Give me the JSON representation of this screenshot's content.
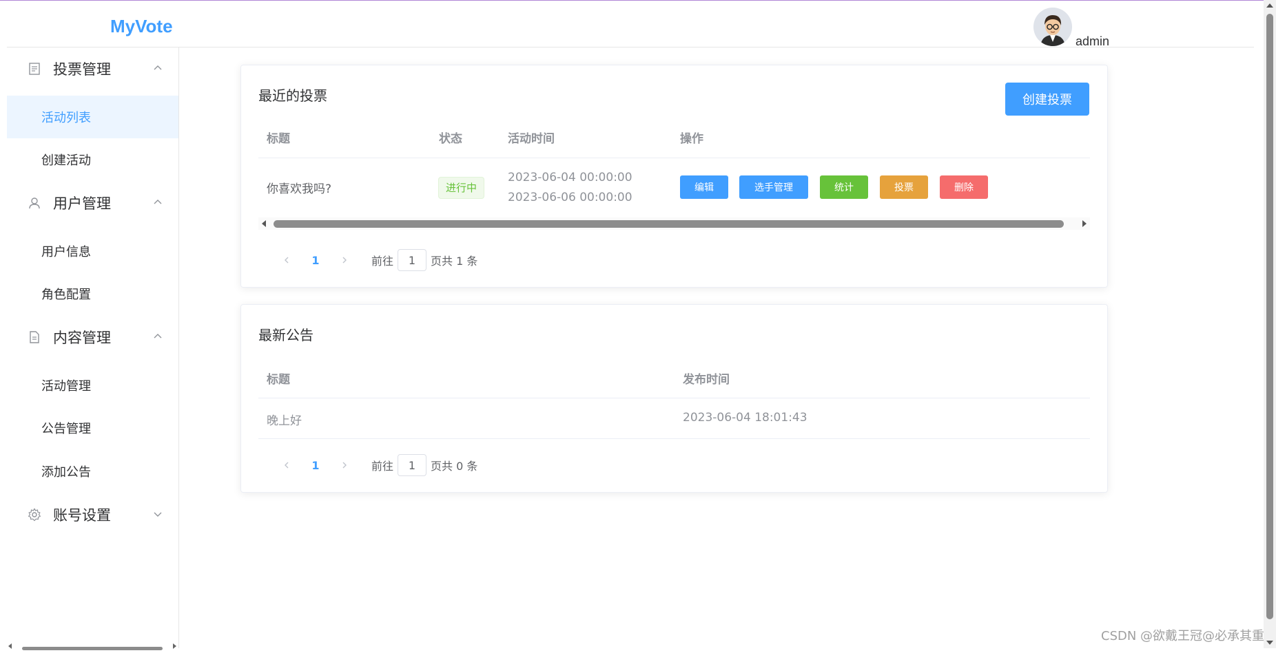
{
  "app": {
    "brand": "MyVote",
    "username": "admin"
  },
  "sidebar": {
    "groups": [
      {
        "label": "投票管理",
        "icon": "document-icon",
        "expanded": true,
        "items": [
          {
            "label": "活动列表",
            "active": true
          },
          {
            "label": "创建活动"
          }
        ]
      },
      {
        "label": "用户管理",
        "icon": "user-icon",
        "expanded": true,
        "items": [
          {
            "label": "用户信息"
          },
          {
            "label": "角色配置"
          }
        ]
      },
      {
        "label": "内容管理",
        "icon": "file-icon",
        "expanded": true,
        "items": [
          {
            "label": "活动管理"
          },
          {
            "label": "公告管理"
          },
          {
            "label": "添加公告"
          }
        ]
      },
      {
        "label": "账号设置",
        "icon": "gear-icon",
        "expanded": false,
        "items": []
      }
    ]
  },
  "votes": {
    "title": "最近的投票",
    "create_label": "创建投票",
    "columns": [
      "标题",
      "状态",
      "活动时间",
      "操作"
    ],
    "rows": [
      {
        "title": "你喜欢我吗?",
        "status": "进行中",
        "start": "2023-06-04 00:00:00",
        "end": "2023-06-06 00:00:00"
      }
    ],
    "actions": [
      "编辑",
      "选手管理",
      "统计",
      "投票",
      "删除"
    ],
    "pager": {
      "current": "1",
      "goto_prefix": "前往",
      "goto_value": "1",
      "goto_suffix": "页",
      "total": "共 1 条"
    }
  },
  "notices": {
    "title": "最新公告",
    "columns": [
      "标题",
      "发布时间"
    ],
    "rows": [
      {
        "title": "晚上好",
        "time": "2023-06-04 18:01:43"
      }
    ],
    "pager": {
      "current": "1",
      "goto_prefix": "前往",
      "goto_value": "1",
      "goto_suffix": "页",
      "total": "共 0 条"
    }
  },
  "colors": {
    "primary": "#409eff",
    "success": "#67c23a",
    "warning": "#e6a23c",
    "danger": "#f56c6c"
  },
  "watermark": "CSDN @欲戴王冠@必承其重"
}
